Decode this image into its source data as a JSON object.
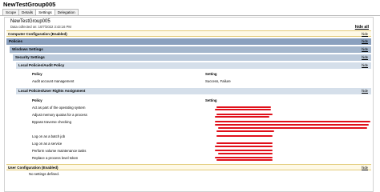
{
  "window": {
    "title": "NewTestGroup005"
  },
  "tabs": [
    "Scope",
    "Details",
    "Settings",
    "Delegation"
  ],
  "report": {
    "name": "NewTestGroup005",
    "data_collected": "Data collected on: 10/7/2022 3:43:16 PM",
    "hide_all": "hide all",
    "hide": "hide",
    "computer_config": "Computer Configuration (Enabled)",
    "policies": "Policies",
    "windows_settings": "Windows Settings",
    "security_settings": "Security Settings",
    "audit_policy_header": "Local Policies/Audit Policy",
    "audit_columns": {
      "policy": "Policy",
      "setting": "Setting"
    },
    "audit_rows": [
      {
        "policy": "Audit account management",
        "setting": "Success, Failure"
      }
    ],
    "rights_header": "Local Policies/User Rights Assignment",
    "rights_columns": {
      "policy": "Policy",
      "setting": "Setting"
    },
    "rights_rows": [
      "Act as part of the operating system",
      "Adjust memory quotas for a process",
      "Bypass traverse checking",
      "Log on as a batch job",
      "Log on as a service",
      "Perform volume maintenance tasks",
      "Replace a process level token"
    ],
    "user_config": "User Configuration (Enabled)",
    "user_no_settings": "No settings defined."
  },
  "colors": {
    "redaction": "#e0101a",
    "level1": "#8aa0be",
    "section_bg": "#fef9e6"
  }
}
